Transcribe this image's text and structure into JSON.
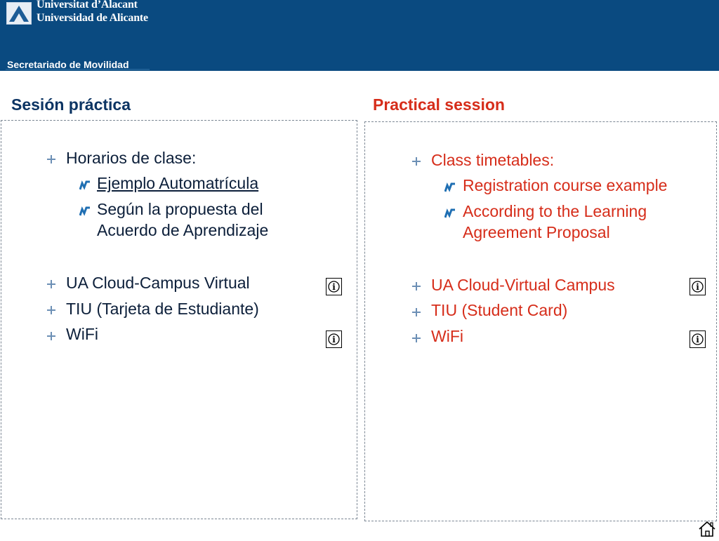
{
  "header": {
    "university_name_line1": "Universitat d’Alacant",
    "university_name_line2": "Universidad de Alicante",
    "department": "Secretariado  de  Movilidad",
    "background_color": "#0a4a80"
  },
  "spanish": {
    "title": "Sesión práctica",
    "items": [
      {
        "label": "Horarios de clase:"
      },
      {
        "label": "Ejemplo Automatrícula"
      },
      {
        "label_line1": "Según la propuesta del",
        "label_line2": "Acuerdo de Aprendizaje"
      },
      {
        "label": "UA Cloud-Campus Virtual"
      },
      {
        "label": "TIU (Tarjeta de Estudiante)"
      },
      {
        "label": "WiFi"
      }
    ]
  },
  "english": {
    "title": "Practical session",
    "items": [
      {
        "label": "Class timetables:"
      },
      {
        "label": "Registration course example"
      },
      {
        "label_line1": "According to the Learning",
        "label_line2": "Agreement Proposal"
      },
      {
        "label": "UA Cloud-Virtual Campus"
      },
      {
        "label": "TIU (Student Card)"
      },
      {
        "label": "WiFi"
      }
    ]
  },
  "colors": {
    "spanish_text": "#0c1f3a",
    "spanish_title": "#0c3463",
    "english_text": "#d62d1a",
    "bullet": "#6c8fb5"
  },
  "icons": {
    "bullet": "cross-bullet-icon",
    "sub_bullet": "wave-arrow-icon",
    "info": "info-icon",
    "home": "home-icon"
  }
}
